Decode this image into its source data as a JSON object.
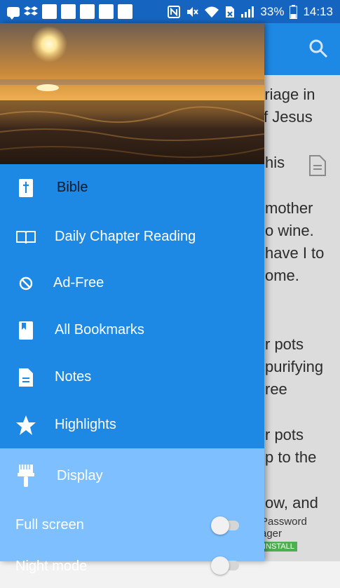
{
  "status_bar": {
    "battery": "33%",
    "time": "14:13"
  },
  "background": {
    "lines": [
      "rriage in",
      "f Jesus",
      "his",
      "mother",
      "o wine.",
      "have I to",
      "ome.",
      "r pots",
      "purifying",
      "ree",
      "r pots",
      "p to the",
      "ow, and"
    ],
    "ad_text": [
      "Password",
      "ager"
    ],
    "ad_button": "INSTALL"
  },
  "drawer": {
    "items": [
      {
        "label": "Bible",
        "icon": "bible-icon"
      },
      {
        "label": "Daily Chapter Reading",
        "icon": "open-book-icon"
      },
      {
        "label": "Ad-Free",
        "icon": "block-icon"
      },
      {
        "label": "All Bookmarks",
        "icon": "bookmark-icon"
      },
      {
        "label": "Notes",
        "icon": "note-icon"
      },
      {
        "label": "Highlights",
        "icon": "star-icon"
      }
    ],
    "display": {
      "label": "Display",
      "icon": "brush-icon"
    },
    "settings": [
      {
        "label": "Full screen",
        "on": false
      },
      {
        "label": "Night mode",
        "on": false
      }
    ]
  }
}
